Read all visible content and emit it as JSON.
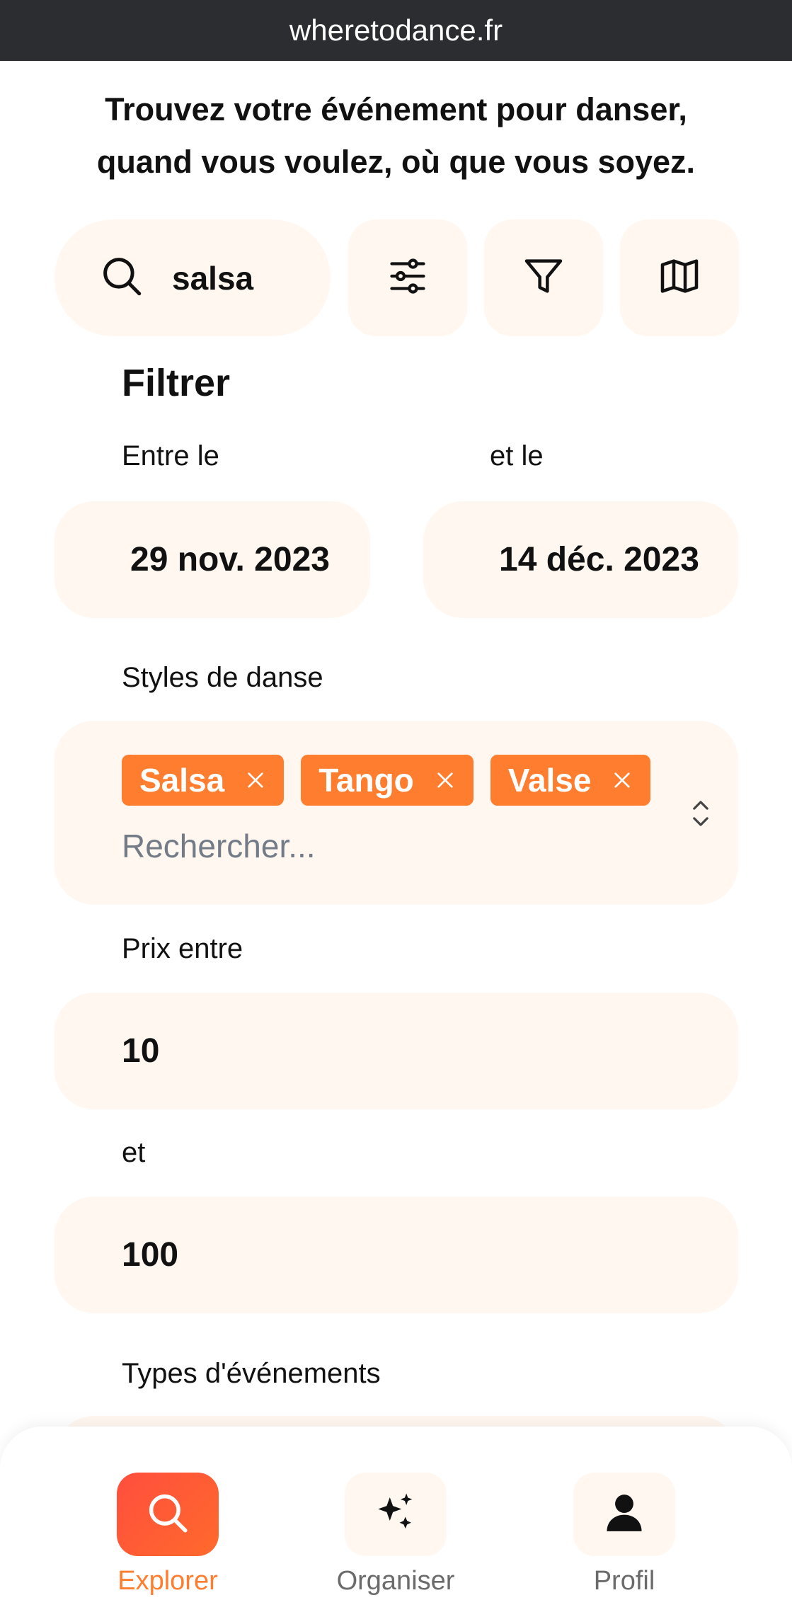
{
  "browser": {
    "url": "wheretodance.fr"
  },
  "header": {
    "headline_line1": "Trouvez votre événement pour danser,",
    "headline_line2": "quand vous voulez, où que vous soyez."
  },
  "search": {
    "value": "salsa",
    "icon": "search-icon"
  },
  "toolbar": {
    "icons": [
      "sliders-icon",
      "funnel-icon",
      "map-icon"
    ]
  },
  "filter": {
    "title": "Filtrer",
    "date_from_label": "Entre le",
    "date_to_label": "et le",
    "date_from": "29 nov. 2023",
    "date_to": "14 déc. 2023",
    "styles_label": "Styles de danse",
    "styles": [
      {
        "label": "Salsa"
      },
      {
        "label": "Tango"
      },
      {
        "label": "Valse"
      }
    ],
    "styles_placeholder": "Rechercher...",
    "price_label": "Prix entre",
    "price_min": "10",
    "price_and_label": "et",
    "price_max": "100",
    "event_types_label": "Types d'événements"
  },
  "nav": {
    "items": [
      {
        "label": "Explorer",
        "icon": "search-icon",
        "active": true
      },
      {
        "label": "Organiser",
        "icon": "sparkles-icon",
        "active": false
      },
      {
        "label": "Profil",
        "icon": "user-icon",
        "active": false
      }
    ]
  },
  "colors": {
    "accent": "#ff7d2e",
    "field_bg": "#fff7f0",
    "urlbar_bg": "#2c2d30"
  }
}
